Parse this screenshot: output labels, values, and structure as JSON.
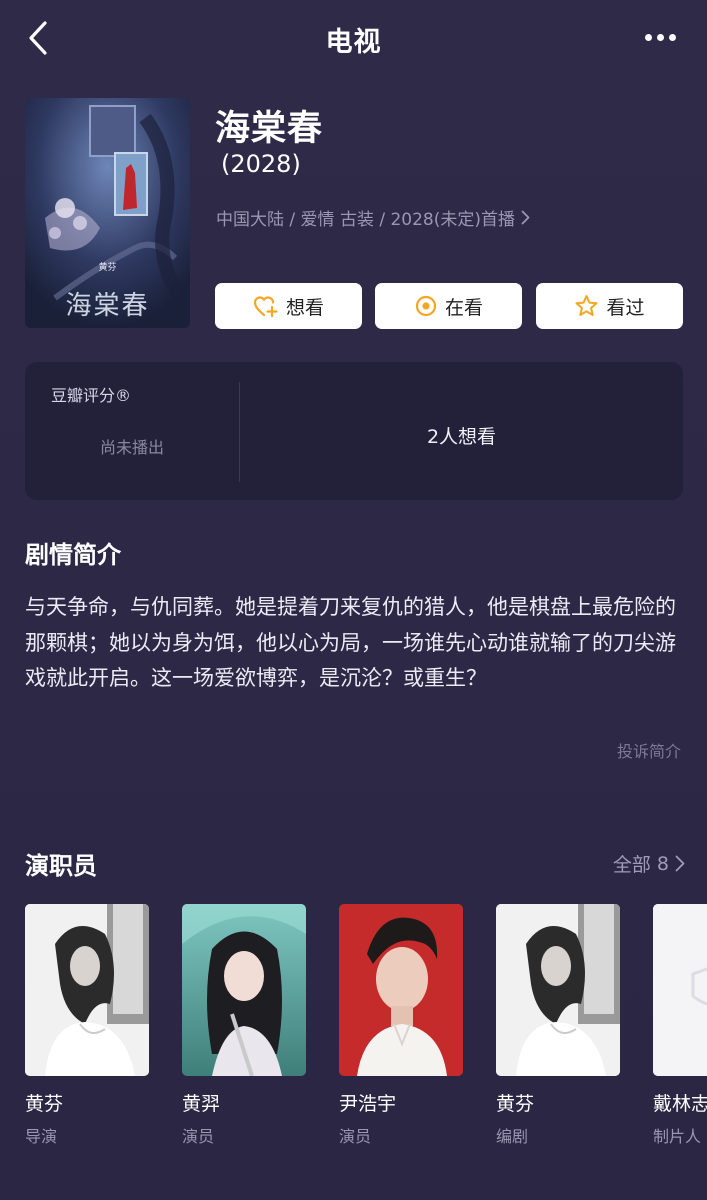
{
  "nav": {
    "title": "电视",
    "back_icon": "chevron-left-icon",
    "more_icon": "more-dots-icon"
  },
  "show": {
    "title": "海棠春",
    "year": "(2028)",
    "meta": "中国大陆 / 爱情 古装 / 2028(未定)首播",
    "poster": {
      "title_art": "海棠春",
      "credit": "黄芬"
    }
  },
  "actions": [
    {
      "label": "想看",
      "icon": "heart-plus-icon",
      "color": "#f5a623"
    },
    {
      "label": "在看",
      "icon": "target-circle-icon",
      "color": "#f5a623"
    },
    {
      "label": "看过",
      "icon": "star-outline-icon",
      "color": "#f5a623"
    }
  ],
  "rating": {
    "label": "豆瓣评分®",
    "status": "尚未播出",
    "want_count": "2人想看"
  },
  "synopsis": {
    "title": "剧情简介",
    "text": "与天争命，与仇同葬。她是提着刀来复仇的猎人，他是棋盘上最危险的那颗棋；她以为身为饵，他以心为局，一场谁先心动谁就输了的刀尖游戏就此开启。这一场爱欲博弈，是沉沦？或重生？",
    "report": "投诉简介"
  },
  "cast": {
    "title": "演职员",
    "all_label": "全部",
    "all_count": "8",
    "members": [
      {
        "name": "黄芬",
        "role": "导演",
        "photo": "woman-bw-portrait"
      },
      {
        "name": "黄羿",
        "role": "演员",
        "photo": "woman-umbrella-portrait"
      },
      {
        "name": "尹浩宇",
        "role": "演员",
        "photo": "man-red-background-portrait"
      },
      {
        "name": "黄芬",
        "role": "编剧",
        "photo": "woman-bw-portrait"
      },
      {
        "name": "戴林志",
        "role": "制片人",
        "photo": "placeholder-avatar"
      }
    ]
  },
  "colors": {
    "background": "#2b2744",
    "card": "#23213a",
    "accent": "#f5a623",
    "muted_text": "#9a97b0"
  }
}
